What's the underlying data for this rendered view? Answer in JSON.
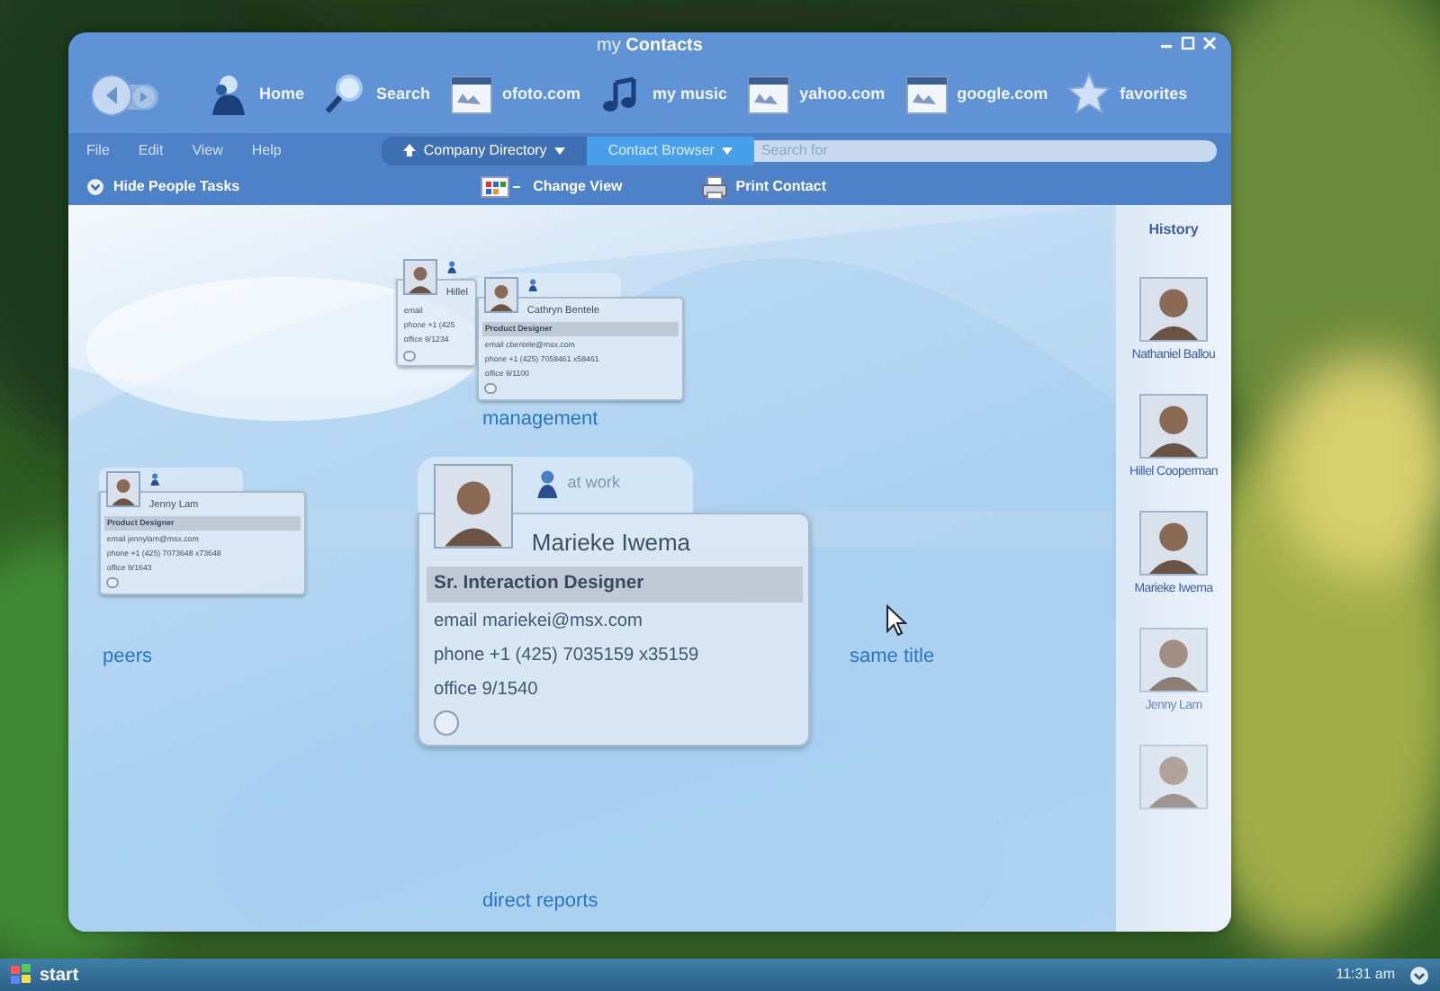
{
  "window": {
    "title": "my **Contacts**"
  },
  "toolbar": [
    {
      "kind": "nav"
    },
    {
      "kind": "home",
      "label": "Home"
    },
    {
      "kind": "search",
      "label": "Search"
    },
    {
      "kind": "web",
      "label": "ofoto.com"
    },
    {
      "kind": "music",
      "label": "my music"
    },
    {
      "kind": "web",
      "label": "yahoo.com"
    },
    {
      "kind": "web",
      "label": "google.com"
    },
    {
      "kind": "star",
      "label": "favorites"
    }
  ],
  "menu": [
    "File",
    "Edit",
    "View",
    "Help"
  ],
  "breadcrumb": [
    {
      "label": "Company Directory",
      "selected": false
    },
    {
      "label": "Contact Browser",
      "selected": true
    }
  ],
  "search": {
    "placeholder": "Search for"
  },
  "tasks": [
    {
      "kind": "collapse",
      "label": "Hide People Tasks"
    },
    {
      "kind": "view",
      "label": "Change View"
    },
    {
      "kind": "print",
      "label": "Print Contact"
    }
  ],
  "groups": [
    {
      "label": "management"
    },
    {
      "label": "peers"
    },
    {
      "label": "same title"
    },
    {
      "label": "direct reports"
    }
  ],
  "cards": [
    {
      "kind": "partial",
      "name": "Hillel",
      "email": "email",
      "phone": "phone +1 (425",
      "office": "office 9/1234"
    },
    {
      "kind": "small",
      "name": "Cathryn Bentele",
      "title": "Product Designer",
      "email": "email cbentele@msx.com",
      "phone": "phone +1 (425) 7058461 x58461",
      "office": "office 9/1100"
    },
    {
      "kind": "small",
      "name": "Jenny Lam",
      "title": "Product Designer",
      "email": "email jennylam@msx.com",
      "phone": "phone +1 (425) 7073648 x73648",
      "office": "office 9/1643"
    },
    {
      "kind": "large",
      "status": "at work",
      "name": "Marieke Iwema",
      "title": "Sr. Interaction Designer",
      "email": "email  mariekei@msx.com",
      "phone": "phone  +1 (425) 7035159 x35159",
      "office": "office  9/1540"
    }
  ],
  "history": {
    "title": "History",
    "people": [
      {
        "name": "Nathaniel Ballou",
        "faded": false
      },
      {
        "name": "Hillel Cooperman",
        "faded": false
      },
      {
        "name": "Marieke Iwema",
        "faded": false
      },
      {
        "name": "Jenny Lam",
        "faded": true
      },
      {
        "faded": true
      }
    ]
  },
  "taskbar": {
    "start": "start",
    "clock": "11:31 am"
  }
}
